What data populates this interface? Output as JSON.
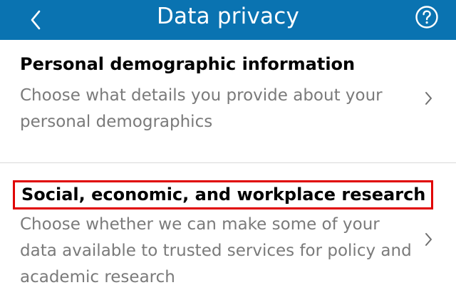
{
  "header": {
    "title": "Data privacy",
    "back_icon": "chevron-left-icon",
    "help_icon": "question-circle-icon",
    "background_color": "#0a73b1"
  },
  "sections": [
    {
      "title": "Personal demographic information",
      "description": "Choose what details you provide about your personal demographics",
      "chevron_icon": "chevron-right-icon"
    },
    {
      "title": "Social, economic, and workplace research",
      "description": "Choose whether we can make some of your data available to trusted services for policy and academic research",
      "chevron_icon": "chevron-right-icon",
      "highlight_color": "#e00000"
    }
  ]
}
